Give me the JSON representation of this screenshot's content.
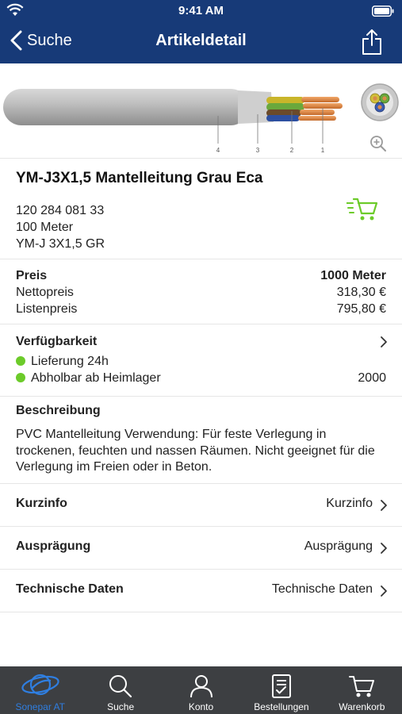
{
  "status_bar": {
    "time": "9:41 AM"
  },
  "nav": {
    "back_label": "Suche",
    "title": "Artikeldetail"
  },
  "image": {
    "markers": [
      "4",
      "3",
      "2",
      "1"
    ]
  },
  "product": {
    "name": "YM-J3X1,5 Mantelleitung Grau Eca",
    "article_number": "120 284 081 33",
    "unit": "100 Meter",
    "short_name": "YM-J 3X1,5 GR"
  },
  "price": {
    "label": "Preis",
    "quantity": "1000 Meter",
    "net_label": "Nettopreis",
    "net_value": "318,30 €",
    "list_label": "Listenpreis",
    "list_value": "795,80 €"
  },
  "availability": {
    "label": "Verfügbarkeit",
    "delivery": "Lieferung 24h",
    "pickup": "Abholbar ab Heimlager",
    "pickup_qty": "2000",
    "status_color": "#6ccb2a"
  },
  "description": {
    "label": "Beschreibung",
    "text": "PVC  Mantelleitung  Verwendung: Für feste Verlegung in trockenen, feuchten und nassen Räumen. Nicht geeignet für die Verlegung im Freien oder in Beton."
  },
  "rows": [
    {
      "label": "Kurzinfo",
      "value": "Kurzinfo"
    },
    {
      "label": "Ausprägung",
      "value": "Ausprägung"
    },
    {
      "label": "Technische Daten",
      "value": "Technische Daten"
    }
  ],
  "tabs": [
    {
      "label": "Sonepar AT",
      "icon": "sonepar-logo-icon",
      "active": true
    },
    {
      "label": "Suche",
      "icon": "search-icon"
    },
    {
      "label": "Konto",
      "icon": "person-icon"
    },
    {
      "label": "Bestellungen",
      "icon": "orders-icon"
    },
    {
      "label": "Warenkorb",
      "icon": "cart-icon"
    }
  ],
  "colors": {
    "brand": "#173a78",
    "accent": "#2f7ee0",
    "cart_green": "#6ccb2a",
    "tabbar": "#3d3f42"
  }
}
